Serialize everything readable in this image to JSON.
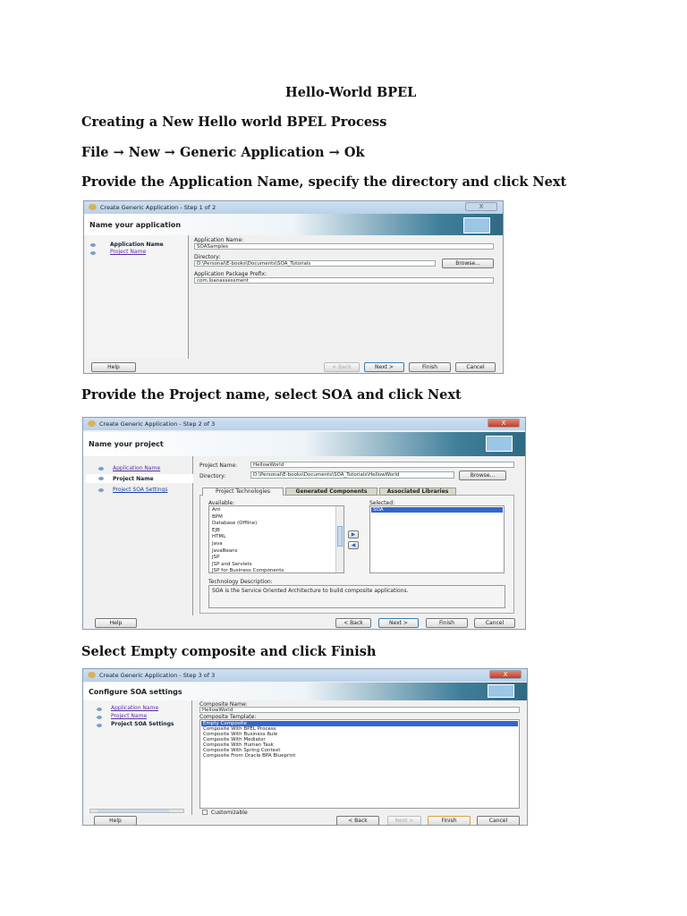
{
  "doc": {
    "title": "Hello-World BPEL",
    "subtitle": "Creating a New Hello world BPEL Process",
    "path": "File → New → Generic Application → Ok",
    "step1_text": "Provide the Application Name, specify the directory and click Next",
    "step2_text": "Provide the Project name, select SOA and click Next",
    "step3_text": "Select Empty composite and click Finish"
  },
  "d1": {
    "title": "Create Generic Application - Step 1 of 2",
    "header": "Name your application",
    "nav": [
      "Application Name",
      "Project Name"
    ],
    "app_name_label": "Application Name:",
    "app_name": "SOASamples",
    "dir_label": "Directory:",
    "dir": "D:\\Personal\\E-books\\Documents\\SOA_Tutorials",
    "browse": "Browse...",
    "prefix_label": "Application Package Prefix:",
    "prefix": "com.loanassessment",
    "buttons": {
      "help": "Help",
      "back": "< Back",
      "next": "Next >",
      "finish": "Finish",
      "cancel": "Cancel"
    },
    "close": "X"
  },
  "d2": {
    "title": "Create Generic Application - Step 2 of 3",
    "header": "Name your project",
    "nav": [
      "Application Name",
      "Project Name",
      "Project SOA Settings"
    ],
    "proj_label": "Project Name:",
    "proj": "HellowWorld",
    "dir_label": "Directory:",
    "dir": "D:\\Personal\\E-books\\Documents\\SOA_Tutorials\\HellowWorld",
    "browse": "Browse...",
    "tabs": [
      "Project Technologies",
      "Generated Components",
      "Associated Libraries"
    ],
    "available_label": "Available:",
    "available": [
      "Ant",
      "BPM",
      "Database (Offline)",
      "EJB",
      "HTML",
      "Java",
      "JavaBeans",
      "JSP",
      "JSP and Servlets",
      "JSP for Business Components"
    ],
    "selected_label": "Selected:",
    "selected": [
      "SOA"
    ],
    "add": "▶",
    "remove": "◀",
    "desc_label": "Technology Description:",
    "desc": "SOA is the Service Oriented Architecture to build composite applications.",
    "buttons": {
      "help": "Help",
      "back": "< Back",
      "next": "Next >",
      "finish": "Finish",
      "cancel": "Cancel"
    },
    "close": "X"
  },
  "d3": {
    "title": "Create Generic Application - Step 3 of 3",
    "header": "Configure SOA settings",
    "nav": [
      "Application Name",
      "Project Name",
      "Project SOA Settings"
    ],
    "name_label": "Composite Name:",
    "name": "HellowWorld",
    "tmpl_label": "Composite Template:",
    "templates": [
      "Empty Composite",
      "Composite With BPEL Process",
      "Composite With Business Rule",
      "Composite With Mediator",
      "Composite With Human Task",
      "Composite With Spring Context",
      "Composite From Oracle BPA Blueprint"
    ],
    "customizable": "Customizable",
    "buttons": {
      "help": "Help",
      "back": "< Back",
      "next": "Next >",
      "finish": "Finish",
      "cancel": "Cancel"
    },
    "close": "X"
  }
}
